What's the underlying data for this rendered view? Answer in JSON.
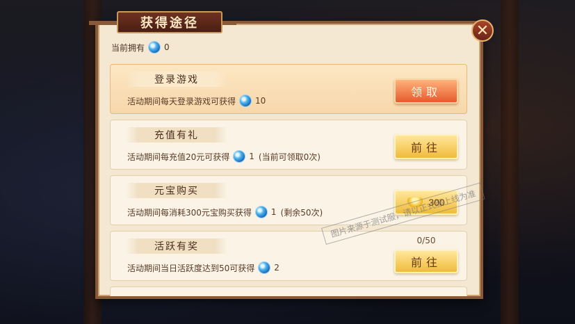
{
  "title": "获得途径",
  "owned": {
    "label": "当前拥有",
    "value": "0"
  },
  "items": [
    {
      "title": "登录游戏",
      "desc": "活动期间每天登录游戏可获得",
      "reward": "10",
      "suffix": "",
      "button": "领取"
    },
    {
      "title": "充值有礼",
      "desc": "活动期间每充值20元可获得",
      "reward": "1",
      "suffix": "(当前可领取0次)",
      "button": "前往"
    },
    {
      "title": "元宝购买",
      "desc": "活动期间每消耗300元宝购买获得",
      "reward": "1",
      "suffix": "(剩余50次)",
      "button": "300"
    },
    {
      "title": "活跃有奖",
      "desc": "活动期间当日活跃度达到50可获得",
      "reward": "2",
      "suffix": "",
      "button": "前往",
      "progress": "0/50"
    }
  ],
  "watermark": "图片来源于测试服，请以正式服上线为准",
  "icons": {
    "currency": "blue-gem-icon",
    "price": "gold-ingot-icon",
    "close": "close-icon"
  }
}
